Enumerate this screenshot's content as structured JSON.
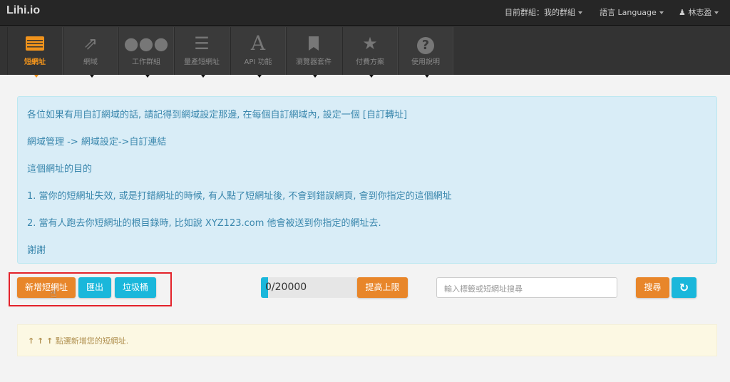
{
  "brand": "Lihi.io",
  "topmenu": {
    "group": "目前群組：我的群組",
    "language": "語言 Language",
    "user": "林志盈"
  },
  "tabs": [
    {
      "label": "短網址",
      "icon": "list-icon",
      "active": true
    },
    {
      "label": "網域",
      "icon": "external-link-icon"
    },
    {
      "label": "工作群組",
      "icon": "users-icon"
    },
    {
      "label": "量產短網址",
      "icon": "th-list-icon"
    },
    {
      "label": "API 功能",
      "icon": "font-icon"
    },
    {
      "label": "瀏覽器套件",
      "icon": "bookmark-icon"
    },
    {
      "label": "付費方案",
      "icon": "star-icon"
    },
    {
      "label": "使用說明",
      "icon": "question-icon"
    }
  ],
  "info": [
    "各位如果有用自訂網域的話, 請記得到網域設定那邊, 在每個自訂網域內, 設定一個 [自訂轉址]",
    "網域管理 -> 網域設定->自訂連結",
    "這個網址的目的",
    "1. 當你的短網址失效, 或是打錯網址的時候, 有人點了短網址後, 不會到錯誤網頁, 會到你指定的這個網址",
    "2. 當有人跑去你短網址的根目錄時, 比如說 XYZ123.com 他會被送到你指定的網址去.",
    "謝謝"
  ],
  "toolbar": {
    "add": "新增短網址",
    "export": "匯出",
    "trash": "垃圾桶",
    "usage": "0/20000",
    "usage_fraction": 0.0,
    "raise": "提高上限",
    "search_placeholder": "輸入標籤或短網址搜尋",
    "search": "搜尋"
  },
  "hint": {
    "arrows": "↑ ↑ ↑",
    "text": "點選新增您的短網址."
  }
}
